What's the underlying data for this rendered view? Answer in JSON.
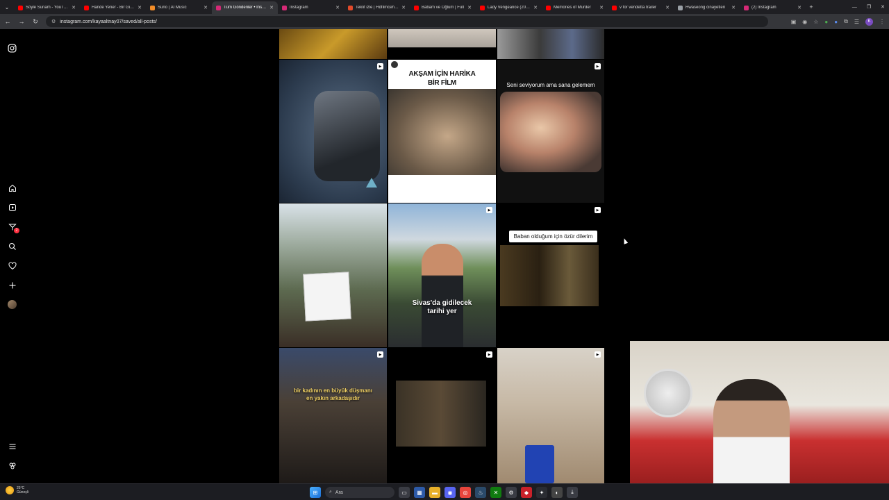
{
  "browser": {
    "tabs": [
      {
        "title": "Söyle Sunam - YouTube",
        "color": "#ff0000",
        "active": false
      },
      {
        "title": "Hande Yener - Bir Gidiş",
        "color": "#ff0000",
        "active": false
      },
      {
        "title": "Suno | AI Music",
        "color": "#f28c28",
        "active": false
      },
      {
        "title": "Tüm Gönderiler • Instagram",
        "color": "#d62976",
        "active": true
      },
      {
        "title": "Instagram",
        "color": "#d62976",
        "active": false
      },
      {
        "title": "Teklif izle | Hdfilmcehennemi",
        "color": "#e24a2a",
        "active": false
      },
      {
        "title": "Babam ve Oğlum | Full",
        "color": "#ff0000",
        "active": false
      },
      {
        "title": "Lady Vengeance (2005)",
        "color": "#ff0000",
        "active": false
      },
      {
        "title": "Memories of Murder",
        "color": "#ff0000",
        "active": false
      },
      {
        "title": "v for vendetta trailer",
        "color": "#ff0000",
        "active": false
      },
      {
        "title": "Hwaseong cinayetleri",
        "color": "#9aa0a6",
        "active": false
      },
      {
        "title": "(2) Instagram",
        "color": "#d62976",
        "active": false
      }
    ],
    "url": "instagram.com/kayaaltnay07/saved/all-posts/"
  },
  "sidebar": {
    "icons": [
      "instagram-logo-icon",
      "home-icon",
      "reels-icon",
      "messages-icon",
      "search-icon",
      "notifications-icon",
      "create-icon",
      "profile-avatar",
      "menu-icon",
      "threads-icon"
    ],
    "message_badge": "2"
  },
  "grid": {
    "posts": [
      {
        "id": "p1",
        "overlay": ""
      },
      {
        "id": "p2",
        "overlay": ""
      },
      {
        "id": "p3",
        "overlay": ""
      },
      {
        "id": "p4",
        "overlay": ""
      },
      {
        "id": "p5",
        "overlay_line1": "AKŞAM İÇİN HARİKA",
        "overlay_line2": "BİR FİLM"
      },
      {
        "id": "p6",
        "overlay": "Seni seviyorum ama sana gelemem"
      },
      {
        "id": "p7",
        "overlay": ""
      },
      {
        "id": "p8",
        "overlay_line1": "Sivas'da gidilecek",
        "overlay_line2": "tarihi yer"
      },
      {
        "id": "p9",
        "overlay": "Baban olduğum için özür dilerim"
      },
      {
        "id": "p10",
        "overlay_line1": "bir kadının en büyük düşmanı",
        "overlay_line2": "en yakın arkadaşıdır"
      },
      {
        "id": "p11",
        "overlay": ""
      },
      {
        "id": "p12",
        "overlay": ""
      }
    ]
  },
  "taskbar": {
    "weather_temp": "25°C",
    "weather_desc": "Güneşli",
    "search_placeholder": "Ara"
  }
}
